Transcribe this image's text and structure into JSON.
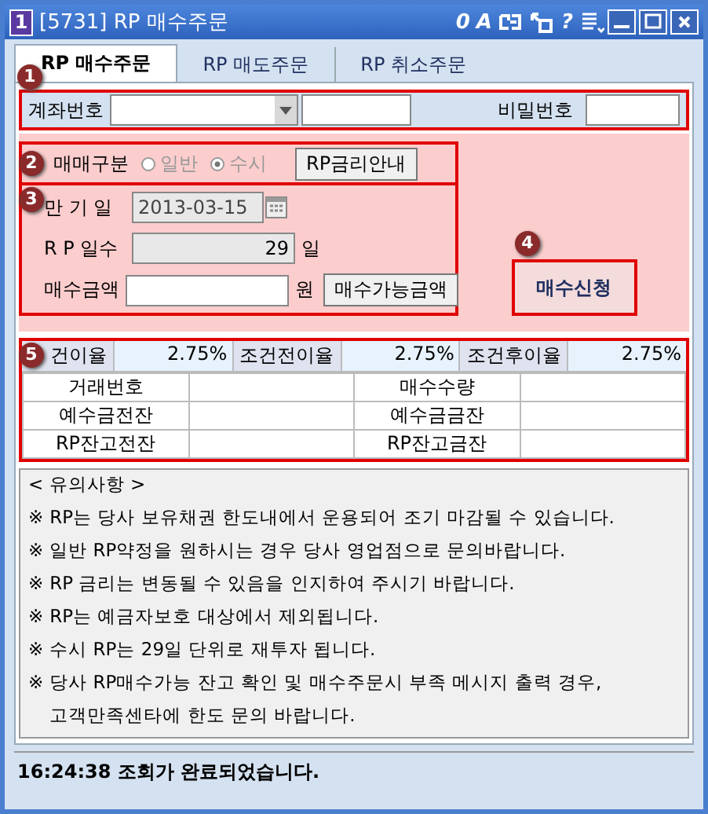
{
  "window": {
    "badge": "1",
    "title": "[5731] RP 매수주문",
    "tools": [
      {
        "kind": "text",
        "label": "0"
      },
      {
        "kind": "text",
        "label": "A"
      },
      {
        "kind": "link"
      },
      {
        "kind": "resize"
      },
      {
        "kind": "text",
        "label": "?"
      },
      {
        "kind": "list"
      }
    ]
  },
  "tabs": [
    {
      "label": "RP 매수주문",
      "selected": true
    },
    {
      "label": "RP 매도주문",
      "selected": false
    },
    {
      "label": "RP 취소주문",
      "selected": false
    }
  ],
  "markers": [
    "1",
    "2",
    "3",
    "4",
    "5"
  ],
  "account": {
    "label": "계좌번호",
    "password_label": "비밀번호"
  },
  "trade_type": {
    "label": "매매구분",
    "disabled": true,
    "options": [
      {
        "label": "일반",
        "selected": false
      },
      {
        "label": "수시",
        "selected": true
      }
    ],
    "button": "RP금리안내"
  },
  "maturity": {
    "label": "만 기 일",
    "value": "2013-03-15"
  },
  "rp_days": {
    "label": "R P 일수",
    "value": "29",
    "unit": "일"
  },
  "amount": {
    "label": "매수금액",
    "unit": "원",
    "button": "매수가능금액"
  },
  "submit": "매수신청",
  "rates": [
    {
      "label": "건이율",
      "value": "2.75%"
    },
    {
      "label": "조건전이율",
      "value": "2.75%"
    },
    {
      "label": "조건후이율",
      "value": "2.75%"
    }
  ],
  "info_rows": [
    [
      "거래번호",
      "매수수량"
    ],
    [
      "예수금전잔",
      "예수금금잔"
    ],
    [
      "RP잔고전잔",
      "RP잔고금잔"
    ]
  ],
  "notes": {
    "title": "< 유의사항 >",
    "items": [
      {
        "mark": "※",
        "lines": [
          "RP는 당사 보유채권 한도내에서 운용되어 조기 마감될 수 있습니다."
        ]
      },
      {
        "mark": "※",
        "lines": [
          "일반 RP약정을 원하시는 경우 당사 영업점으로 문의바랍니다."
        ]
      },
      {
        "mark": "※",
        "lines": [
          "RP 금리는 변동될 수 있음을 인지하여 주시기 바랍니다."
        ]
      },
      {
        "mark": "※",
        "lines": [
          "RP는 예금자보호 대상에서 제외됩니다."
        ]
      },
      {
        "mark": "※",
        "lines": [
          "수시 RP는 29일 단위로 재투자 됩니다."
        ]
      },
      {
        "mark": "※",
        "lines": [
          "당사 RP매수가능 잔고 확인 및 매수주문시 부족 메시지 출력 경우,",
          "고객만족센타에 한도 문의 바랍니다."
        ]
      }
    ]
  },
  "status": "16:24:38 조회가 완료되었습니다."
}
